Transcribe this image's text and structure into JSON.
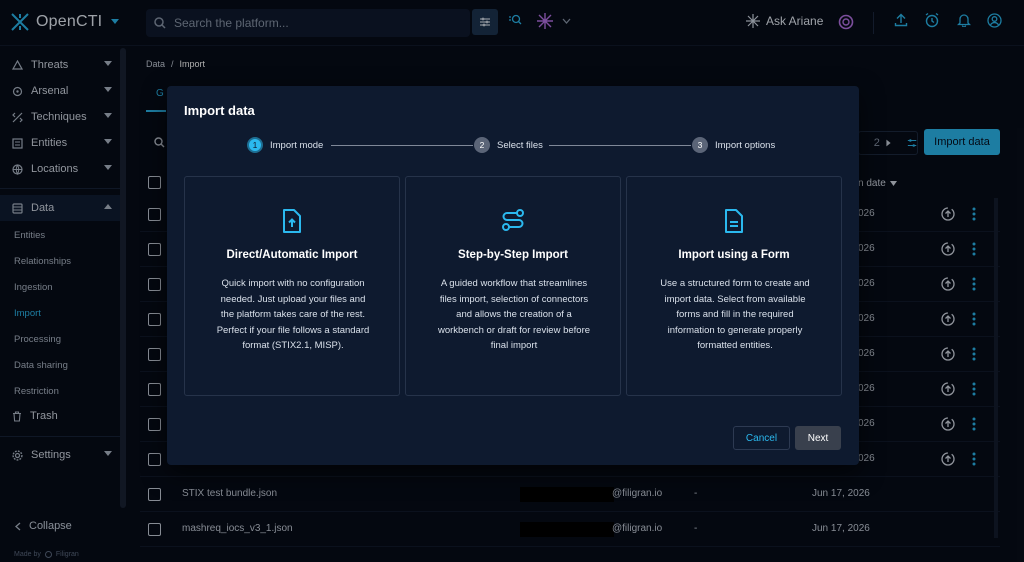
{
  "app": {
    "name": "OpenCTI",
    "search_placeholder": "Search the platform...",
    "ask_label": "Ask Ariane"
  },
  "sidebar": {
    "items": [
      {
        "label": "Threats",
        "icon": "threats-icon"
      },
      {
        "label": "Arsenal",
        "icon": "arsenal-icon"
      },
      {
        "label": "Techniques",
        "icon": "techniques-icon"
      },
      {
        "label": "Entities",
        "icon": "entities-icon"
      },
      {
        "label": "Locations",
        "icon": "locations-icon"
      },
      {
        "label": "Data",
        "icon": "data-icon"
      }
    ],
    "data_sub": [
      "Entities",
      "Relationships",
      "Ingestion",
      "Import",
      "Processing",
      "Data sharing",
      "Restriction"
    ],
    "trash_label": "Trash",
    "settings_label": "Settings",
    "collapse_label": "Collapse",
    "made_by": "Made by",
    "made_by_brand": "Filigran"
  },
  "breadcrumb": {
    "root": "Data",
    "sep": "/",
    "current": "Import"
  },
  "page": {
    "tab_fragment": "G",
    "pager_number": "2",
    "import_button": "Import data",
    "date_header": "n date",
    "rows": [
      {
        "date": "026"
      },
      {
        "date": "026"
      },
      {
        "date": "026"
      },
      {
        "date": "026"
      },
      {
        "date": "026"
      },
      {
        "date": "026"
      },
      {
        "date": "026"
      },
      {
        "date": "026"
      },
      {
        "name": "STIX test bundle.json",
        "email": "@filigran.io",
        "dash": "-",
        "date": "Jun 17, 2026"
      },
      {
        "name": "mashreq_iocs_v3_1.json",
        "email": "@filigran.io",
        "dash": "-",
        "date": "Jun 17, 2026"
      }
    ]
  },
  "dialog": {
    "title": "Import data",
    "steps": [
      {
        "num": "1",
        "label": "Import mode"
      },
      {
        "num": "2",
        "label": "Select files"
      },
      {
        "num": "3",
        "label": "Import options"
      }
    ],
    "cards": [
      {
        "title": "Direct/Automatic Import",
        "desc": "Quick import with no configuration needed. Just upload your files and the platform takes care of the rest. Perfect if your file follows a standard format (STIX2.1, MISP)."
      },
      {
        "title": "Step-by-Step Import",
        "desc": "A guided workflow that streamlines files import, selection of connectors and allows the creation of a workbench or draft for review before final import"
      },
      {
        "title": "Import using a Form",
        "desc": "Use a structured form to create and import data. Select from available forms and fill in the required information to generate properly formatted entities."
      }
    ],
    "cancel": "Cancel",
    "next": "Next"
  },
  "colors": {
    "accent": "#2bb9ef",
    "background": "#070d19",
    "dialog": "#0e1a2f"
  }
}
